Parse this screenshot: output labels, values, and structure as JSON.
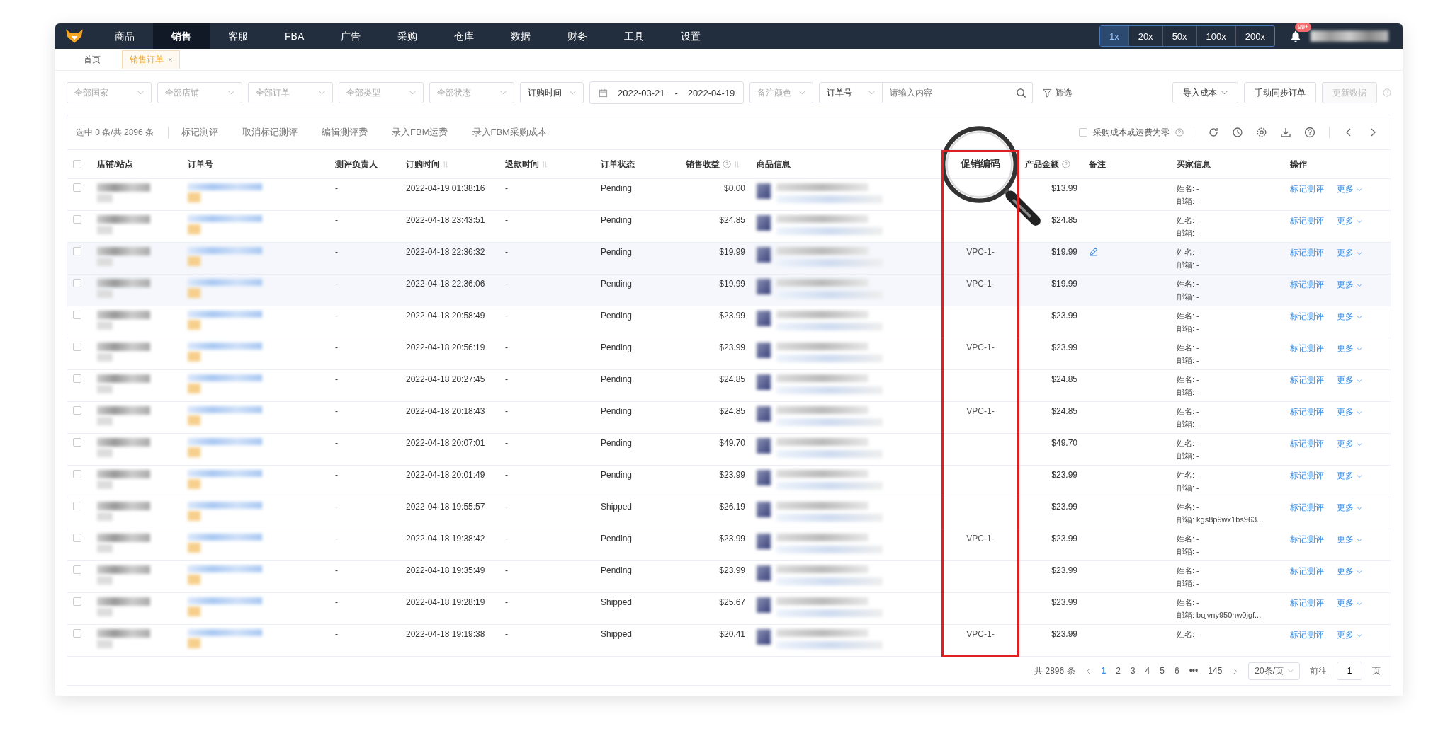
{
  "nav": {
    "items": [
      {
        "label": "商品",
        "selected": false
      },
      {
        "label": "销售",
        "selected": true
      },
      {
        "label": "客服",
        "selected": false
      },
      {
        "label": "FBA",
        "selected": false
      },
      {
        "label": "广告",
        "selected": false
      },
      {
        "label": "采购",
        "selected": false
      },
      {
        "label": "仓库",
        "selected": false
      },
      {
        "label": "数据",
        "selected": false
      },
      {
        "label": "财务",
        "selected": false
      },
      {
        "label": "工具",
        "selected": false
      },
      {
        "label": "设置",
        "selected": false
      }
    ],
    "zoom_buttons": [
      {
        "label": "1x",
        "selected": true
      },
      {
        "label": "20x",
        "selected": false
      },
      {
        "label": "50x",
        "selected": false
      },
      {
        "label": "100x",
        "selected": false
      },
      {
        "label": "200x",
        "selected": false
      }
    ],
    "notification_badge": "99+"
  },
  "page_tabs": [
    {
      "label": "首页",
      "selected": false,
      "closable": false
    },
    {
      "label": "销售订单",
      "selected": true,
      "closable": true,
      "close": "×"
    }
  ],
  "filters": {
    "selects": [
      {
        "placeholder": "全部国家"
      },
      {
        "placeholder": "全部店铺"
      },
      {
        "placeholder": "全部订单"
      },
      {
        "placeholder": "全部类型"
      },
      {
        "placeholder": "全部状态"
      }
    ],
    "date_type": "订购时间",
    "date_from": "2022-03-21",
    "date_sep": "-",
    "date_to": "2022-04-19",
    "note_color": "备注颜色",
    "search_type": "订单号",
    "search": {
      "placeholder": "请输入内容"
    },
    "filter_button": "筛选",
    "buttons": [
      {
        "label": "导入成本",
        "kind": "dropdown",
        "disabled": false
      },
      {
        "label": "手动同步订单",
        "kind": "plain",
        "disabled": false
      },
      {
        "label": "更新数据",
        "kind": "plain",
        "disabled": true
      }
    ]
  },
  "toolbar": {
    "selection": "选中 0 条/共 2896 条",
    "actions": [
      "标记测评",
      "取消标记测评",
      "编辑测评费",
      "录入FBM运费",
      "录入FBM采购成本"
    ],
    "zero_cost_option": {
      "label": "采购成本或运费为零",
      "checked": false
    }
  },
  "table": {
    "select_all_checked": false,
    "columns": [
      {
        "label": "店铺/站点",
        "kind": "plain"
      },
      {
        "label": "订单号",
        "kind": "plain"
      },
      {
        "label": "测评负责人",
        "kind": "plain"
      },
      {
        "label": "订购时间",
        "kind": "sortable"
      },
      {
        "label": "退款时间",
        "kind": "sortable"
      },
      {
        "label": "订单状态",
        "kind": "plain"
      },
      {
        "label": "销售收益",
        "kind": "help_sortable"
      },
      {
        "label": "商品信息",
        "kind": "plain"
      },
      {
        "label": "促销编码",
        "kind": "plain"
      },
      {
        "label": "产品金额",
        "kind": "help"
      },
      {
        "label": "备注",
        "kind": "plain"
      },
      {
        "label": "买家信息",
        "kind": "plain"
      },
      {
        "label": "操作",
        "kind": "plain"
      }
    ],
    "rows": [
      {
        "checked": false,
        "reviewer": "-",
        "order_time": "2022-04-19 01:38:16",
        "refund_time": "-",
        "status": "Pending",
        "revenue": "$0.00",
        "promo_code": "",
        "amount": "$13.99",
        "buyer_name": "姓名: -",
        "buyer_email": "邮箱: -",
        "action": "标记测评",
        "more": "更多"
      },
      {
        "checked": false,
        "reviewer": "-",
        "order_time": "2022-04-18 23:43:51",
        "refund_time": "-",
        "status": "Pending",
        "revenue": "$24.85",
        "promo_code": "",
        "amount": "$24.85",
        "buyer_name": "姓名: -",
        "buyer_email": "邮箱: -",
        "action": "标记测评",
        "more": "更多"
      },
      {
        "checked": false,
        "reviewer": "-",
        "order_time": "2022-04-18 22:36:32",
        "refund_time": "-",
        "status": "Pending",
        "revenue": "$19.99",
        "promo_code": "VPC-1-",
        "amount": "$19.99",
        "note": {
          "kind": "edit"
        },
        "buyer_name": "姓名: -",
        "buyer_email": "邮箱: -",
        "action": "标记测评",
        "more": "更多"
      },
      {
        "checked": false,
        "reviewer": "-",
        "order_time": "2022-04-18 22:36:06",
        "refund_time": "-",
        "status": "Pending",
        "revenue": "$19.99",
        "promo_code": "VPC-1-",
        "amount": "$19.99",
        "buyer_name": "姓名: -",
        "buyer_email": "邮箱: -",
        "action": "标记测评",
        "more": "更多"
      },
      {
        "checked": false,
        "reviewer": "-",
        "order_time": "2022-04-18 20:58:49",
        "refund_time": "-",
        "status": "Pending",
        "revenue": "$23.99",
        "promo_code": "",
        "amount": "$23.99",
        "buyer_name": "姓名: -",
        "buyer_email": "邮箱: -",
        "action": "标记测评",
        "more": "更多"
      },
      {
        "checked": false,
        "reviewer": "-",
        "order_time": "2022-04-18 20:56:19",
        "refund_time": "-",
        "status": "Pending",
        "revenue": "$23.99",
        "promo_code": "VPC-1-",
        "amount": "$23.99",
        "buyer_name": "姓名: -",
        "buyer_email": "邮箱: -",
        "action": "标记测评",
        "more": "更多"
      },
      {
        "checked": false,
        "reviewer": "-",
        "order_time": "2022-04-18 20:27:45",
        "refund_time": "-",
        "status": "Pending",
        "revenue": "$24.85",
        "promo_code": "",
        "amount": "$24.85",
        "buyer_name": "姓名: -",
        "buyer_email": "邮箱: -",
        "action": "标记测评",
        "more": "更多"
      },
      {
        "checked": false,
        "reviewer": "-",
        "order_time": "2022-04-18 20:18:43",
        "refund_time": "-",
        "status": "Pending",
        "revenue": "$24.85",
        "promo_code": "VPC-1-",
        "amount": "$24.85",
        "buyer_name": "姓名: -",
        "buyer_email": "邮箱: -",
        "action": "标记测评",
        "more": "更多"
      },
      {
        "checked": false,
        "reviewer": "-",
        "order_time": "2022-04-18 20:07:01",
        "refund_time": "-",
        "status": "Pending",
        "revenue": "$49.70",
        "promo_code": "",
        "amount": "$49.70",
        "buyer_name": "姓名: -",
        "buyer_email": "邮箱: -",
        "action": "标记测评",
        "more": "更多"
      },
      {
        "checked": false,
        "reviewer": "-",
        "order_time": "2022-04-18 20:01:49",
        "refund_time": "-",
        "status": "Pending",
        "revenue": "$23.99",
        "promo_code": "",
        "amount": "$23.99",
        "buyer_name": "姓名: -",
        "buyer_email": "邮箱: -",
        "action": "标记测评",
        "more": "更多"
      },
      {
        "checked": false,
        "reviewer": "-",
        "order_time": "2022-04-18 19:55:57",
        "refund_time": "-",
        "status": "Shipped",
        "revenue": "$26.19",
        "promo_code": "",
        "amount": "$23.99",
        "buyer_name": "姓名: -",
        "buyer_email": "邮箱: kgs8p9wx1bs963...",
        "action": "标记测评",
        "more": "更多"
      },
      {
        "checked": false,
        "reviewer": "-",
        "order_time": "2022-04-18 19:38:42",
        "refund_time": "-",
        "status": "Pending",
        "revenue": "$23.99",
        "promo_code": "VPC-1-",
        "amount": "$23.99",
        "buyer_name": "姓名: -",
        "buyer_email": "邮箱: -",
        "action": "标记测评",
        "more": "更多"
      },
      {
        "checked": false,
        "reviewer": "-",
        "order_time": "2022-04-18 19:35:49",
        "refund_time": "-",
        "status": "Pending",
        "revenue": "$23.99",
        "promo_code": "",
        "amount": "$23.99",
        "buyer_name": "姓名: -",
        "buyer_email": "邮箱: -",
        "action": "标记测评",
        "more": "更多"
      },
      {
        "checked": false,
        "reviewer": "-",
        "order_time": "2022-04-18 19:28:19",
        "refund_time": "-",
        "status": "Shipped",
        "revenue": "$25.67",
        "promo_code": "",
        "amount": "$23.99",
        "buyer_name": "姓名: -",
        "buyer_email": "邮箱: bqjvny950nw0jgf...",
        "action": "标记测评",
        "more": "更多"
      },
      {
        "checked": false,
        "reviewer": "-",
        "order_time": "2022-04-18 19:19:38",
        "refund_time": "-",
        "status": "Shipped",
        "revenue": "$20.41",
        "promo_code": "VPC-1-",
        "amount": "$23.99",
        "buyer_name": "姓名: -",
        "buyer_email": "",
        "action": "标记测评",
        "more": "更多"
      }
    ]
  },
  "pagination": {
    "total": "共 2896 条",
    "pages": [
      {
        "label": "1",
        "selected": true
      },
      {
        "label": "2",
        "selected": false
      },
      {
        "label": "3",
        "selected": false
      },
      {
        "label": "4",
        "selected": false
      },
      {
        "label": "5",
        "selected": false
      },
      {
        "label": "6",
        "selected": false
      }
    ],
    "ellipsis": "•••",
    "last_page": "145",
    "page_size": "20条/页",
    "goto_label": "前往",
    "goto_value": "1",
    "goto_suffix": "页"
  }
}
